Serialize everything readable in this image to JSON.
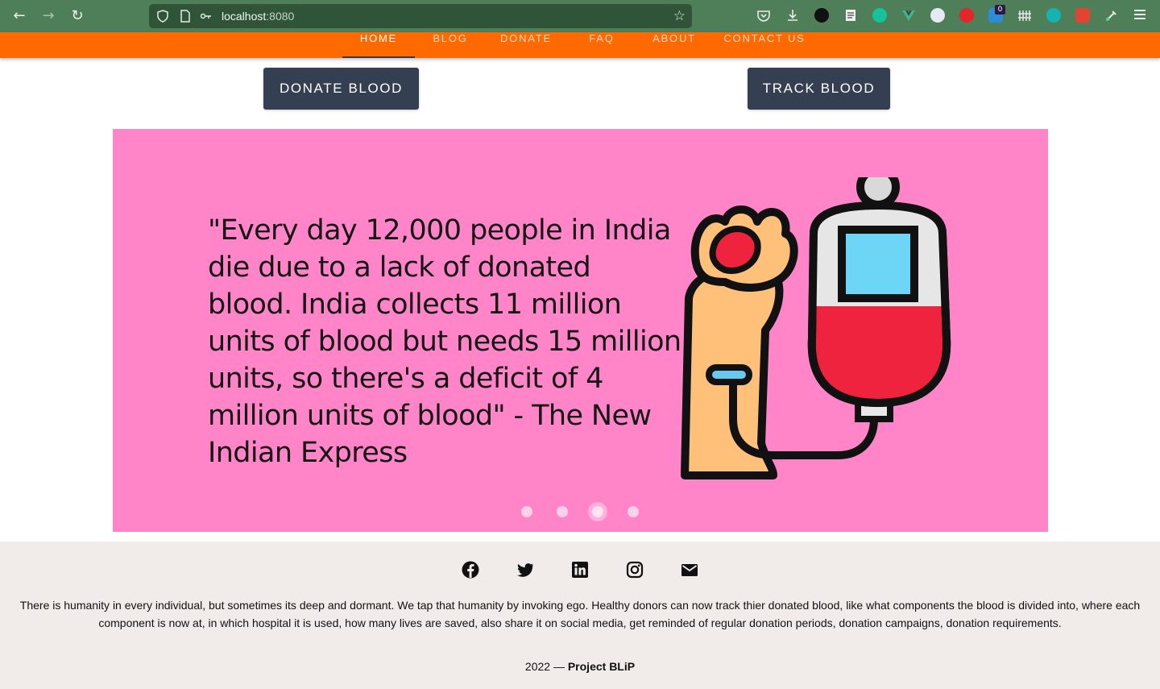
{
  "browser": {
    "url_host": "localhost",
    "url_port": ":8080",
    "badge_count": "0"
  },
  "nav": {
    "items": [
      {
        "label": "HOME",
        "active": true
      },
      {
        "label": "BLOG"
      },
      {
        "label": "DONATE"
      },
      {
        "label": "FAQ"
      },
      {
        "label": "ABOUT"
      },
      {
        "label": "CONTACT US"
      }
    ]
  },
  "cta": {
    "donate_label": "DONATE BLOOD",
    "track_label": "TRACK BLOOD"
  },
  "carousel": {
    "quote": "\"Every day 12,000 people in India die due to a lack of donated blood. India collects 11 million units of blood but needs 15 million units, so there's a deficit of 4 million units of blood\" - The New Indian Express",
    "slide_count": 4,
    "active_slide": 3
  },
  "footer": {
    "social": [
      "facebook-icon",
      "twitter-icon",
      "linkedin-icon",
      "instagram-icon",
      "email-icon"
    ],
    "about_text": "There is humanity in every individual, but sometimes its deep and dormant. We tap that humanity by invoking ego. Healthy donors can now track thier donated blood, like what components the blood is divided into, where each component is now at, in which hospital it is used, how many lives are saved, also share it on social media, get reminded of regular donation periods, donation campaigns, donation requirements.",
    "year": "2022 —",
    "project": "Project BLiP"
  },
  "colors": {
    "nav_bg": "#ff6a00",
    "button_bg": "#353f52",
    "carousel_bg": "#ff85c8",
    "footer_bg": "#f1ece9",
    "browser_bg": "#4f7f59"
  }
}
